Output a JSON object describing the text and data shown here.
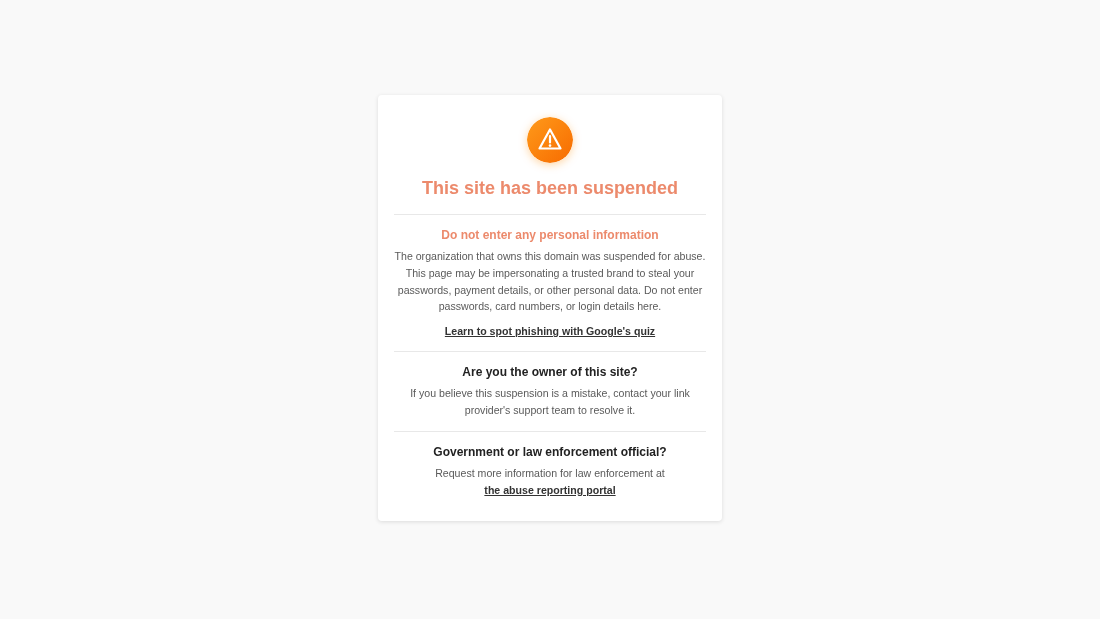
{
  "card": {
    "title": "This site has been suspended",
    "sections": [
      {
        "kind": "warning",
        "heading": "Do not enter any personal information",
        "text": "The organization that owns this domain was suspended for abuse. This page may be impersonating a trusted brand to steal your passwords, payment details, or other personal data. Do not enter passwords, card numbers, or login details here.",
        "link": "Learn to spot phishing with Google's quiz"
      },
      {
        "kind": "info",
        "heading": "Are you the owner of this site?",
        "text": "If you believe this suspension is a mistake, contact your link provider's support team to resolve it."
      },
      {
        "kind": "info",
        "heading": "Government or law enforcement official?",
        "text": "Request more information for law enforcement at",
        "inline_link": "the abuse reporting portal"
      }
    ]
  }
}
